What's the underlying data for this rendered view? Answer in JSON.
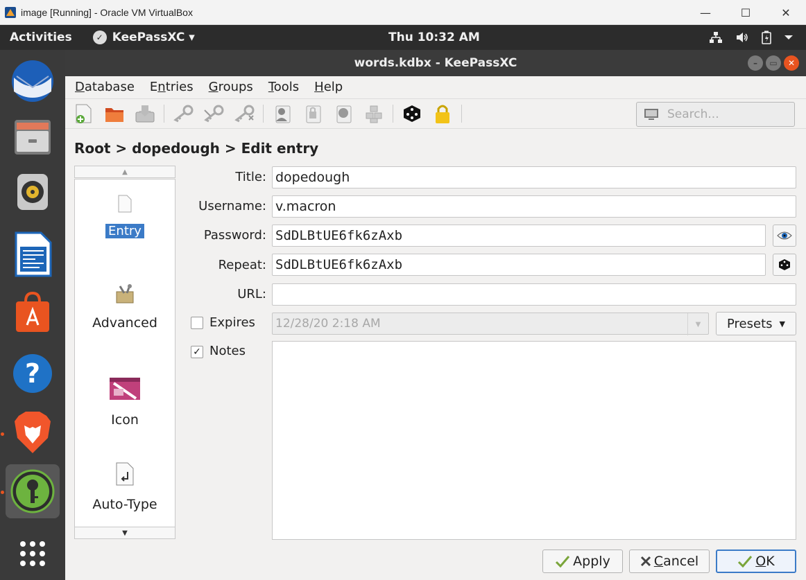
{
  "host_window": {
    "title": "image [Running] - Oracle VM VirtualBox",
    "minimize": "—",
    "maximize": "☐",
    "close": "✕"
  },
  "top_panel": {
    "activities": "Activities",
    "app_name": "KeePassXC ▾",
    "clock": "Thu 10:32 AM",
    "tray": [
      "network-icon",
      "volume-icon",
      "battery-icon",
      "system-menu-icon"
    ]
  },
  "dock": {
    "items": [
      "thunderbird",
      "files",
      "rhythmbox",
      "libreoffice-writer",
      "software",
      "help",
      "brave",
      "keepassxc",
      "show-apps"
    ]
  },
  "window": {
    "title": "words.kdbx - KeePassXC"
  },
  "menu": {
    "database": {
      "mnemonic": "D",
      "rest": "atabase"
    },
    "entries": {
      "pre": "E",
      "mnemonic": "n",
      "rest": "tries"
    },
    "groups": {
      "mnemonic": "G",
      "rest": "roups"
    },
    "tools": {
      "mnemonic": "T",
      "rest": "ools"
    },
    "help": {
      "mnemonic": "H",
      "rest": "elp"
    }
  },
  "search": {
    "placeholder": "Search..."
  },
  "breadcrumb": "Root > dopedough > Edit entry",
  "categories": {
    "entry": "Entry",
    "advanced": "Advanced",
    "icon": "Icon",
    "autotype": "Auto-Type"
  },
  "form": {
    "title_label": "Title:",
    "title_value": "dopedough",
    "username_label": "Username:",
    "username_value": "v.macron",
    "password_label": "Password:",
    "password_value": "SdDLBtUE6fk6zAxb",
    "repeat_label": "Repeat:",
    "repeat_value": "SdDLBtUE6fk6zAxb",
    "url_label": "URL:",
    "url_value": "",
    "expires_label": "Expires",
    "expires_checked": false,
    "expires_value": "12/28/20 2:18 AM",
    "presets_label": "Presets",
    "notes_label": "Notes",
    "notes_checked": true,
    "notes_value": ""
  },
  "buttons": {
    "apply": {
      "mnemonic": "",
      "label": "Apply"
    },
    "cancel": {
      "mnemonic": "C",
      "rest": "ancel"
    },
    "ok": {
      "mnemonic": "O",
      "rest": "K"
    }
  },
  "colors": {
    "selection": "#3b7bc7",
    "ubuntu_orange": "#e95420",
    "panel": "#2c2c2c",
    "dock": "#3a3a3a"
  }
}
